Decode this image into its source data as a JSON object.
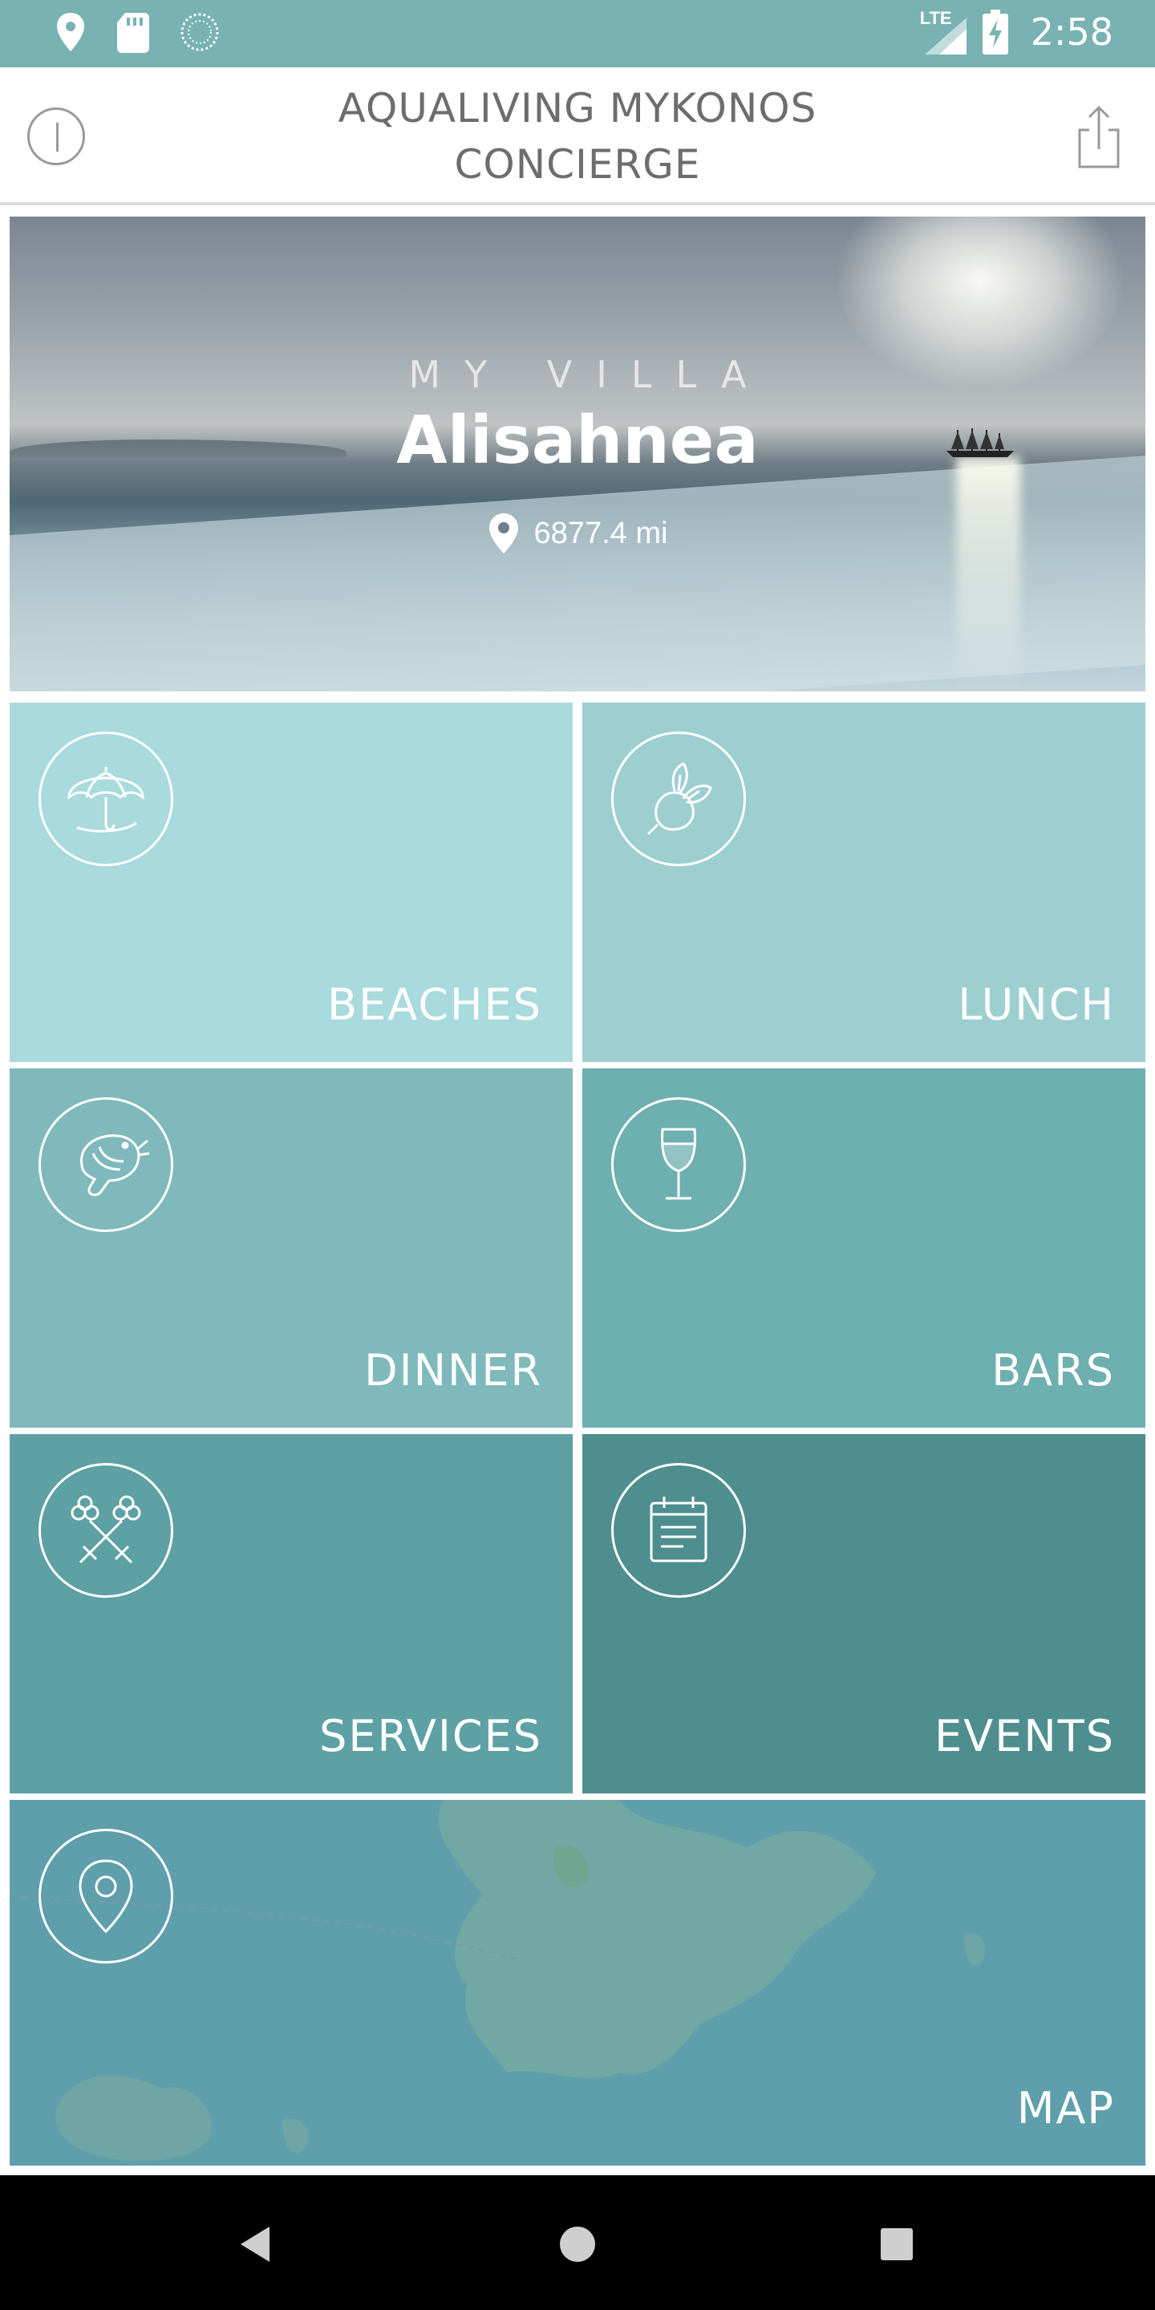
{
  "status_bar": {
    "time": "2:58",
    "network": "LTE",
    "icons": [
      "location-icon",
      "sd-card-icon",
      "loading-icon",
      "signal-icon",
      "battery-charging-icon"
    ]
  },
  "app_bar": {
    "title_line1": "AQUALIVING MYKONOS",
    "title_line2": "CONCIERGE",
    "left_icon": "info-icon",
    "right_icon": "share-icon"
  },
  "hero": {
    "subtitle": "MY VILLA",
    "villa_name": "Alisahnea",
    "distance": "6877.4 mi"
  },
  "tiles": [
    {
      "label": "BEACHES",
      "icon": "umbrella-icon",
      "color": "#a9dadd"
    },
    {
      "label": "LUNCH",
      "icon": "radish-icon",
      "color": "#9dcfd1"
    },
    {
      "label": "DINNER",
      "icon": "shrimp-icon",
      "color": "#7fb9bb"
    },
    {
      "label": "BARS",
      "icon": "wine-glass-icon",
      "color": "#6eafb0"
    },
    {
      "label": "SERVICES",
      "icon": "keys-icon",
      "color": "#5da1a4"
    },
    {
      "label": "EVENTS",
      "icon": "calendar-icon",
      "color": "#4f8e8f"
    },
    {
      "label": "MAP",
      "icon": "map-pin-icon",
      "color": "#5f9fac"
    }
  ],
  "nav_bar": {
    "buttons": [
      "back-icon",
      "home-icon",
      "recents-icon"
    ]
  }
}
